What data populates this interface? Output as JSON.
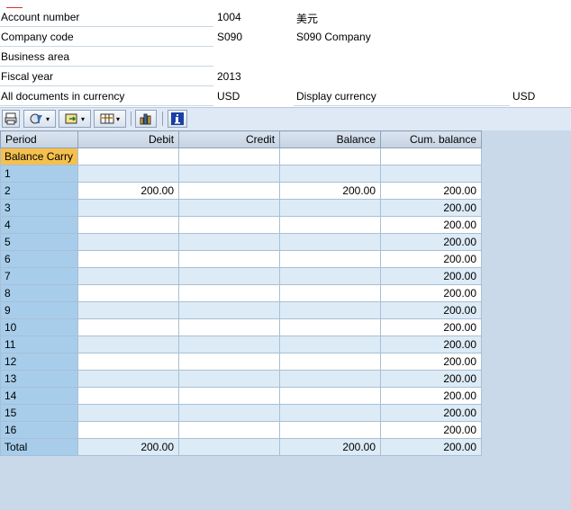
{
  "header": {
    "account_number": {
      "label": "Account number",
      "value": "1004",
      "extra": "美元"
    },
    "company_code": {
      "label": "Company code",
      "value": "S090",
      "extra": "S090 Company"
    },
    "business_area": {
      "label": "Business area",
      "value": ""
    },
    "fiscal_year": {
      "label": "Fiscal year",
      "value": "2013"
    },
    "all_docs": {
      "label": "All documents in currency",
      "value": "USD",
      "display_label": "Display currency",
      "display_value": "USD"
    }
  },
  "toolbar": {
    "buttons": [
      "print-icon",
      "filter-icon",
      "export-icon",
      "layout-icon",
      "chart-icon",
      "info-icon"
    ]
  },
  "table": {
    "columns": [
      "Period",
      "Debit",
      "Credit",
      "Balance",
      "Cum. balance"
    ],
    "rows": [
      {
        "period": "Balance Carry",
        "debit": "",
        "credit": "",
        "balance": "",
        "cum": ""
      },
      {
        "period": "1",
        "debit": "",
        "credit": "",
        "balance": "",
        "cum": ""
      },
      {
        "period": "2",
        "debit": "200.00",
        "credit": "",
        "balance": "200.00",
        "cum": "200.00"
      },
      {
        "period": "3",
        "debit": "",
        "credit": "",
        "balance": "",
        "cum": "200.00"
      },
      {
        "period": "4",
        "debit": "",
        "credit": "",
        "balance": "",
        "cum": "200.00"
      },
      {
        "period": "5",
        "debit": "",
        "credit": "",
        "balance": "",
        "cum": "200.00"
      },
      {
        "period": "6",
        "debit": "",
        "credit": "",
        "balance": "",
        "cum": "200.00"
      },
      {
        "period": "7",
        "debit": "",
        "credit": "",
        "balance": "",
        "cum": "200.00"
      },
      {
        "period": "8",
        "debit": "",
        "credit": "",
        "balance": "",
        "cum": "200.00"
      },
      {
        "period": "9",
        "debit": "",
        "credit": "",
        "balance": "",
        "cum": "200.00"
      },
      {
        "period": "10",
        "debit": "",
        "credit": "",
        "balance": "",
        "cum": "200.00"
      },
      {
        "period": "11",
        "debit": "",
        "credit": "",
        "balance": "",
        "cum": "200.00"
      },
      {
        "period": "12",
        "debit": "",
        "credit": "",
        "balance": "",
        "cum": "200.00"
      },
      {
        "period": "13",
        "debit": "",
        "credit": "",
        "balance": "",
        "cum": "200.00"
      },
      {
        "period": "14",
        "debit": "",
        "credit": "",
        "balance": "",
        "cum": "200.00"
      },
      {
        "period": "15",
        "debit": "",
        "credit": "",
        "balance": "",
        "cum": "200.00"
      },
      {
        "period": "16",
        "debit": "",
        "credit": "",
        "balance": "",
        "cum": "200.00"
      },
      {
        "period": "Total",
        "debit": "200.00",
        "credit": "",
        "balance": "200.00",
        "cum": "200.00"
      }
    ]
  },
  "colors": {
    "key_column": "#a7cdeb",
    "carry_highlight": "#f5c04e",
    "row_alt": "#dcebf6",
    "background": "#c9d9ea"
  }
}
